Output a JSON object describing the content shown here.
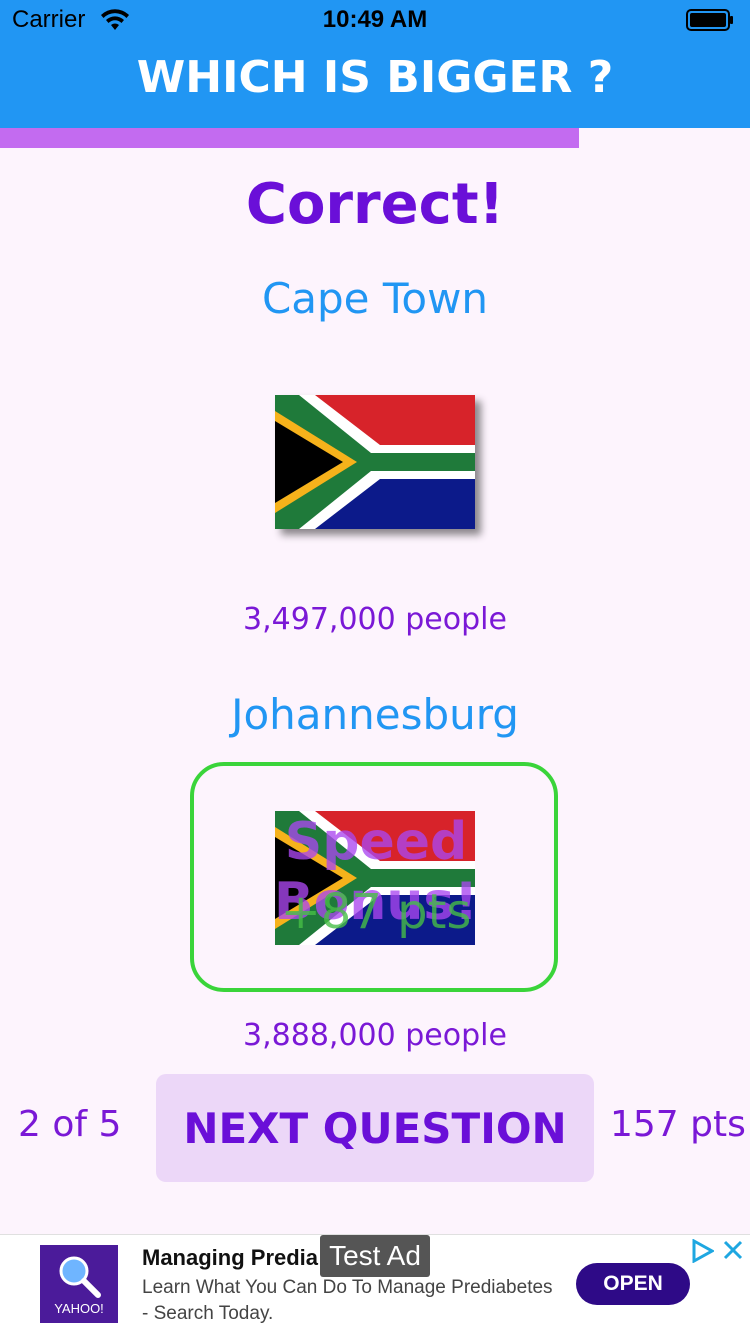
{
  "status_bar": {
    "carrier": "Carrier",
    "time": "10:49 AM",
    "wifi_icon": "wifi-icon",
    "battery_icon": "battery-icon"
  },
  "header": {
    "title": "WHICH IS BIGGER ?",
    "background": "#2196f3"
  },
  "progress": {
    "fraction": 0.772,
    "color": "#c36bf0"
  },
  "result": {
    "label": "Correct!"
  },
  "city_one": {
    "name": "Cape Town",
    "population": "3,497,000 people",
    "flag": "south-africa-flag"
  },
  "city_two": {
    "name": "Johannesburg",
    "population": "3,888,000 people",
    "flag": "south-africa-flag",
    "highlight_color": "#3ad43a"
  },
  "bonus": {
    "label": "Speed Bonus!",
    "points": "+87 pts"
  },
  "footer": {
    "counter": "2 of 5",
    "next_button": "NEXT QUESTION",
    "score": "157 pts"
  },
  "ad": {
    "badge": "Test Ad",
    "title": "Managing Predia",
    "body": "Learn What You Can Do To Manage Prediabetes - Search Today.",
    "logo_text": "YAHOO!",
    "open_button": "OPEN",
    "choices_icon": "adchoices-icon",
    "close_icon": "close-icon"
  }
}
